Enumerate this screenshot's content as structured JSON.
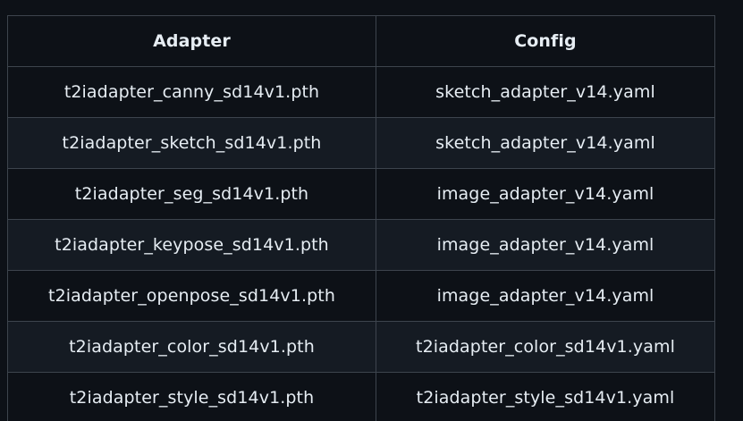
{
  "table": {
    "headers": [
      "Adapter",
      "Config"
    ],
    "rows": [
      [
        "t2iadapter_canny_sd14v1.pth",
        "sketch_adapter_v14.yaml"
      ],
      [
        "t2iadapter_sketch_sd14v1.pth",
        "sketch_adapter_v14.yaml"
      ],
      [
        "t2iadapter_seg_sd14v1.pth",
        "image_adapter_v14.yaml"
      ],
      [
        "t2iadapter_keypose_sd14v1.pth",
        "image_adapter_v14.yaml"
      ],
      [
        "t2iadapter_openpose_sd14v1.pth",
        "image_adapter_v14.yaml"
      ],
      [
        "t2iadapter_color_sd14v1.pth",
        "t2iadapter_color_sd14v1.yaml"
      ],
      [
        "t2iadapter_style_sd14v1.pth",
        "t2iadapter_style_sd14v1.yaml"
      ]
    ]
  },
  "colors": {
    "background": "#0d1117",
    "row_alt": "#151b23",
    "border": "#3d444d",
    "text": "#e6edf3"
  }
}
